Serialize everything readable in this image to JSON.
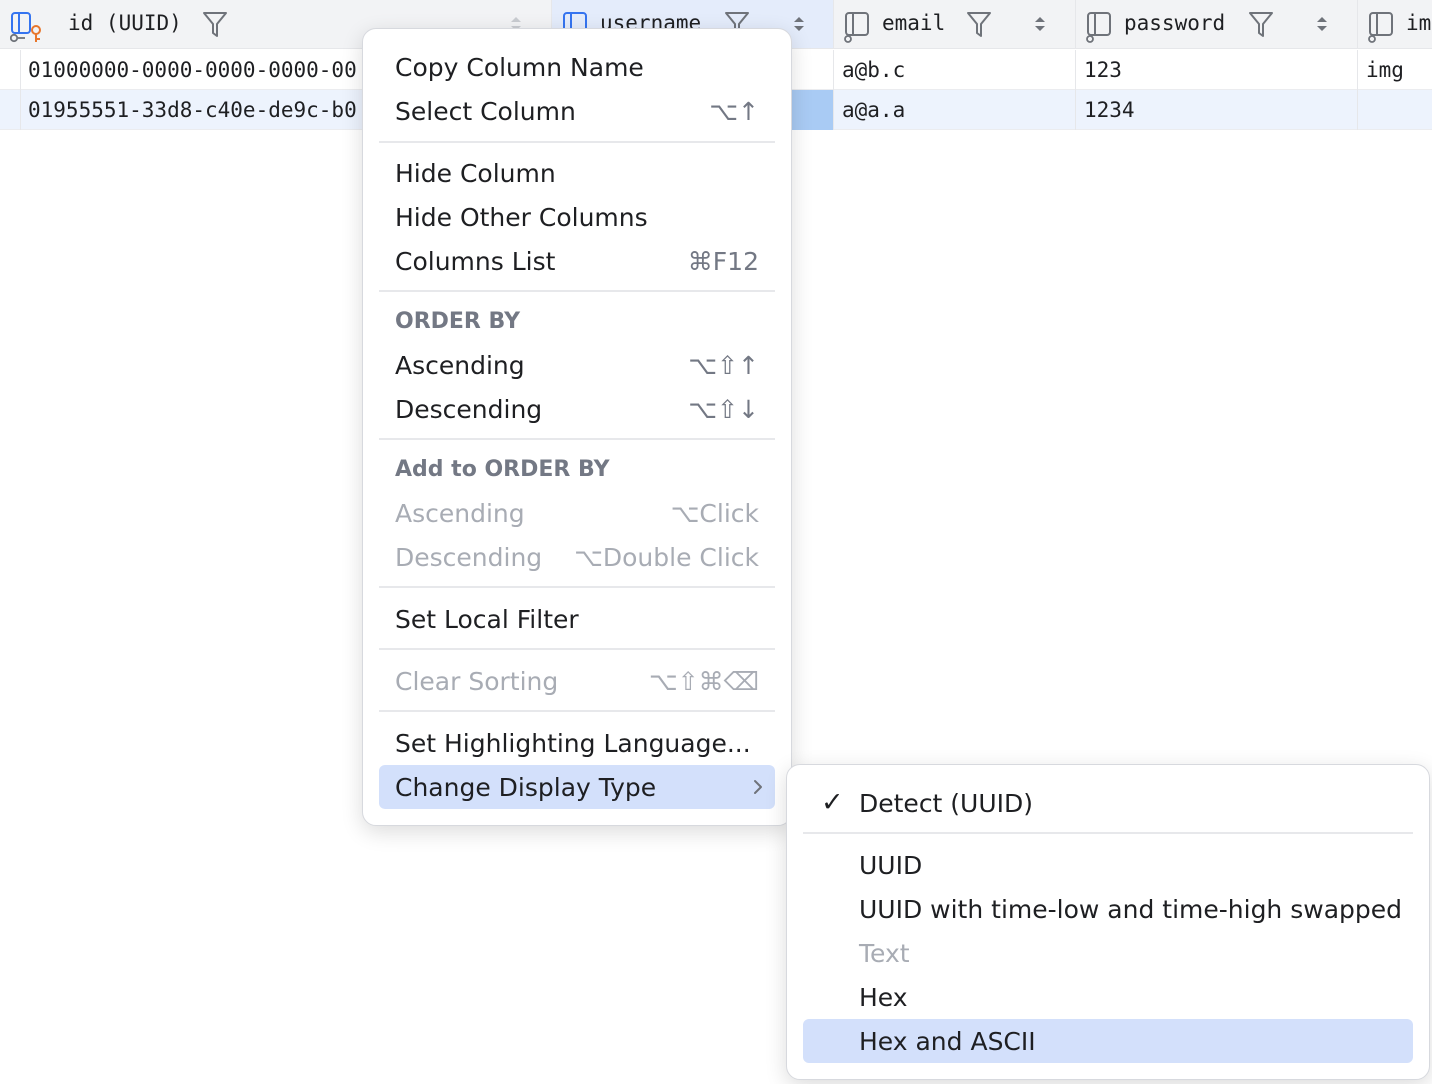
{
  "grid": {
    "columns": [
      {
        "name": "id (UUID)",
        "icon": "primary-key-column-icon"
      },
      {
        "name": "username",
        "icon": "column-icon"
      },
      {
        "name": "email",
        "icon": "column-icon"
      },
      {
        "name": "password",
        "icon": "column-icon"
      },
      {
        "name": "im",
        "icon": "column-icon"
      }
    ],
    "rows": [
      {
        "id": "01000000-0000-0000-0000-00",
        "username": "",
        "email": "a@b.c",
        "password": "123",
        "img": "img"
      },
      {
        "id": "01955551-33d8-c40e-de9c-b0",
        "username": "",
        "email": "a@a.a",
        "password": "1234",
        "img": ""
      }
    ]
  },
  "context_menu": {
    "copy_column_name": "Copy Column Name",
    "select_column": {
      "label": "Select Column",
      "shortcut": "⌥↑"
    },
    "hide_column": "Hide Column",
    "hide_other_columns": "Hide Other Columns",
    "columns_list": {
      "label": "Columns List",
      "shortcut": "⌘F12"
    },
    "order_by_header": "ORDER BY",
    "order_ascending": {
      "label": "Ascending",
      "shortcut": "⌥⇧↑"
    },
    "order_descending": {
      "label": "Descending",
      "shortcut": "⌥⇧↓"
    },
    "add_order_by_header": "Add to ORDER BY",
    "add_ascending": {
      "label": "Ascending",
      "shortcut": "⌥Click"
    },
    "add_descending": {
      "label": "Descending",
      "shortcut": "⌥Double Click"
    },
    "set_local_filter": "Set Local Filter",
    "clear_sorting": {
      "label": "Clear Sorting",
      "shortcut": "⌥⇧⌘⌫"
    },
    "set_highlighting_language": "Set Highlighting Language...",
    "change_display_type": "Change Display Type"
  },
  "submenu": {
    "checkmark": "✓",
    "detect": "Detect (UUID)",
    "uuid": "UUID",
    "uuid_swapped": "UUID with time-low and time-high swapped",
    "text": "Text",
    "hex": "Hex",
    "hex_ascii": "Hex and ASCII"
  },
  "colors": {
    "highlight": "#d3e0fb",
    "selected_row": "#edf3fd",
    "active_cell": "#a9cbf4",
    "key_icon": "#e8762c",
    "column_icon": "#3574f0"
  }
}
